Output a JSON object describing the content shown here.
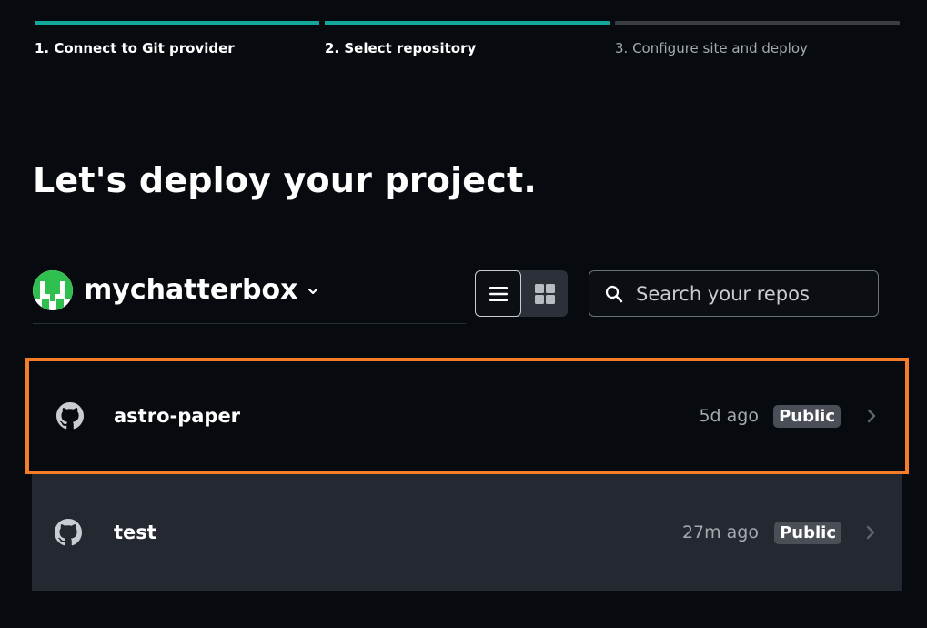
{
  "stepper": {
    "steps": [
      {
        "label": "1. Connect to Git provider",
        "state": "done"
      },
      {
        "label": "2. Select repository",
        "state": "done"
      },
      {
        "label": "3. Configure site and deploy",
        "state": "pending"
      }
    ]
  },
  "page_title": "Let's deploy your project.",
  "account": {
    "name": "mychatterbox",
    "icon": "chevron-down-icon"
  },
  "view_toggle": {
    "active": "list",
    "options": [
      "list-view-icon",
      "grid-view-icon"
    ]
  },
  "search": {
    "placeholder": "Search your repos",
    "value": "",
    "icon": "search-icon"
  },
  "repos": [
    {
      "name": "astro-paper",
      "updated": "5d ago",
      "visibility": "Public",
      "selected": true,
      "icon": "github-icon"
    },
    {
      "name": "test",
      "updated": "27m ago",
      "visibility": "Public",
      "selected": false,
      "icon": "github-icon"
    }
  ],
  "colors": {
    "background": "#070b10",
    "step_done": "#14a79c",
    "step_pending": "#3a3d44",
    "selection_outline": "#f57c28",
    "row_background": "#242831",
    "badge_background": "#4a4e57"
  }
}
